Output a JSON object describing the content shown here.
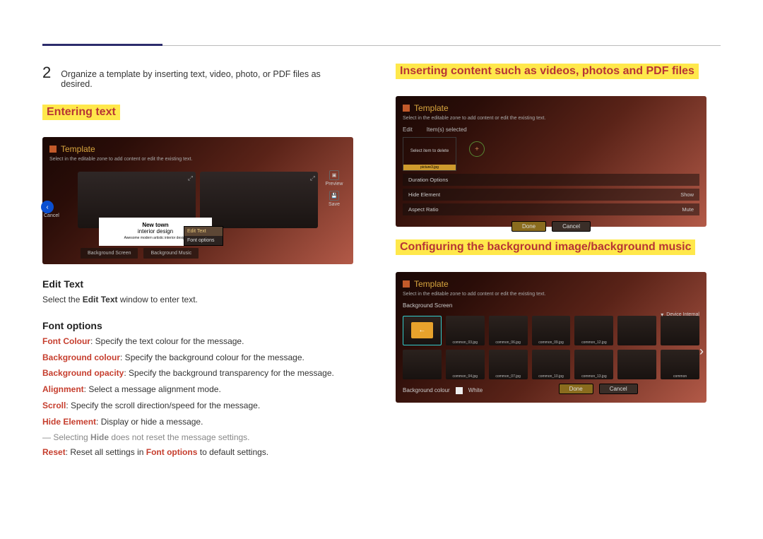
{
  "step": {
    "number": "2",
    "text": "Organize a template by inserting text, video, photo, or PDF files as desired."
  },
  "left": {
    "heading_entering": "Entering text",
    "edit_text_h": "Edit Text",
    "edit_text_body_pre": "Select the ",
    "edit_text_body_kw": "Edit Text",
    "edit_text_body_post": " window to enter text.",
    "font_options_h": "Font options",
    "lines": {
      "font_colour_kw": "Font Colour",
      "font_colour_rest": ": Specify the text colour for the message.",
      "bg_colour_kw": "Background colour",
      "bg_colour_rest": ": Specify the background colour for the message.",
      "bg_opacity_kw": "Background opacity",
      "bg_opacity_rest": ": Specify the background transparency for the message.",
      "alignment_kw": "Alignment",
      "alignment_rest": ": Select a message alignment mode.",
      "scroll_kw": "Scroll",
      "scroll_rest": ": Specify the scroll direction/speed for the message.",
      "hide_kw": "Hide Element",
      "hide_rest": ": Display or hide a message.",
      "note_pre": "Selecting ",
      "note_kw": "Hide",
      "note_post": " does not reset the message settings.",
      "reset_kw": "Reset",
      "reset_mid": ": Reset all settings in ",
      "reset_kw2": "Font options",
      "reset_post": " to default settings."
    }
  },
  "right": {
    "heading_insert": "Inserting content such as videos, photos and PDF files",
    "heading_config": "Configuring the background image/background music"
  },
  "shot1": {
    "title": "Template",
    "desc": "Select in the editable zone to add content or edit the existing text.",
    "cancel": "Cancel",
    "preview": "Preview",
    "save": "Save",
    "text1": "New town",
    "text2": "interior design",
    "text3": "Awesome modern artistic interior design",
    "menu_edit": "Edit Text",
    "menu_font": "Font options",
    "tab_bgscreen": "Background Screen",
    "tab_bgmusic": "Background Music"
  },
  "shot2": {
    "title": "Template",
    "desc": "Select in the editable zone to add content or edit the existing text.",
    "edit": "Edit",
    "items_selected": "Item(s) selected",
    "select_label": "Select item to delete",
    "thumb_caption": "picture3.jpg",
    "plus": "+",
    "duration": "Duration Options",
    "hide": "Hide Element",
    "hide_val": "Show",
    "aspect": "Aspect Ratio",
    "aspect_val": "Mute",
    "done": "Done",
    "cancel": "Cancel"
  },
  "shot3": {
    "title": "Template",
    "desc": "Select in the editable zone to add content or edit the existing text.",
    "bg_screen": "Background Screen",
    "device": "Device Internal",
    "thumbs": [
      "",
      "common_03.jpg",
      "common_06.jpg",
      "common_09.jpg",
      "common_12.jpg",
      "",
      "",
      "",
      "common_04.jpg",
      "common_07.jpg",
      "common_10.jpg",
      "common_13.jpg",
      "",
      "common"
    ],
    "bg_colour_lbl": "Background colour",
    "white": "White",
    "done": "Done",
    "cancel": "Cancel",
    "back": "←"
  }
}
